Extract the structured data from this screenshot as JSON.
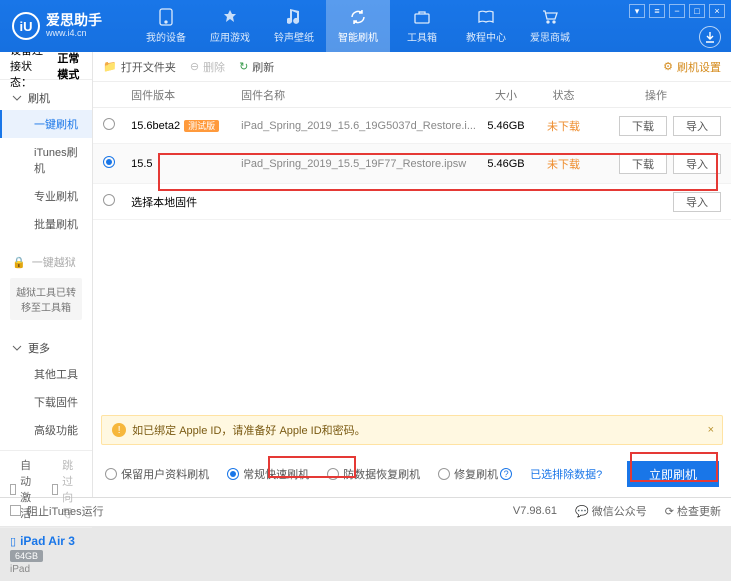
{
  "brand": {
    "name": "爱思助手",
    "url": "www.i4.cn",
    "logoLetter": "iU"
  },
  "nav": [
    {
      "label": "我的设备"
    },
    {
      "label": "应用游戏"
    },
    {
      "label": "铃声壁纸"
    },
    {
      "label": "智能刷机"
    },
    {
      "label": "工具箱"
    },
    {
      "label": "教程中心"
    },
    {
      "label": "爱思商城"
    }
  ],
  "conn": {
    "label": "设备连接状态：",
    "value": "正常模式"
  },
  "sidebar": {
    "flash": {
      "header": "刷机",
      "items": [
        "一键刷机",
        "iTunes刷机",
        "专业刷机",
        "批量刷机"
      ]
    },
    "jailbreak": {
      "header": "一键越狱",
      "note": "越狱工具已转移至工具箱"
    },
    "more": {
      "header": "更多",
      "items": [
        "其他工具",
        "下载固件",
        "高级功能"
      ]
    },
    "auto": {
      "activate": "自动激活",
      "skip": "跳过向导"
    }
  },
  "device": {
    "name": "iPad Air 3",
    "storage": "64GB",
    "type": "iPad"
  },
  "toolbar": {
    "open": "打开文件夹",
    "delete": "删除",
    "refresh": "刷新",
    "settings": "刷机设置"
  },
  "table": {
    "headers": {
      "ver": "固件版本",
      "name": "固件名称",
      "size": "大小",
      "status": "状态",
      "ops": "操作"
    },
    "rows": [
      {
        "ver": "15.6beta2",
        "beta": "测试版",
        "name": "iPad_Spring_2019_15.6_19G5037d_Restore.i...",
        "size": "5.46GB",
        "status": "未下载"
      },
      {
        "ver": "15.5",
        "name": "iPad_Spring_2019_15.5_19F77_Restore.ipsw",
        "size": "5.46GB",
        "status": "未下载"
      }
    ],
    "localRow": "选择本地固件",
    "btns": {
      "download": "下载",
      "import": "导入"
    }
  },
  "notice": "如已绑定 Apple ID，请准备好 Apple ID和密码。",
  "options": {
    "keep": "保留用户资料刷机",
    "normal": "常规快速刷机",
    "antirec": "防数据恢复刷机",
    "repair": "修复刷机",
    "excludeLink": "已选排除数据?",
    "go": "立即刷机"
  },
  "statusbar": {
    "block": "阻止iTunes运行",
    "version": "V7.98.61",
    "wechat": "微信公众号",
    "update": "检查更新"
  }
}
